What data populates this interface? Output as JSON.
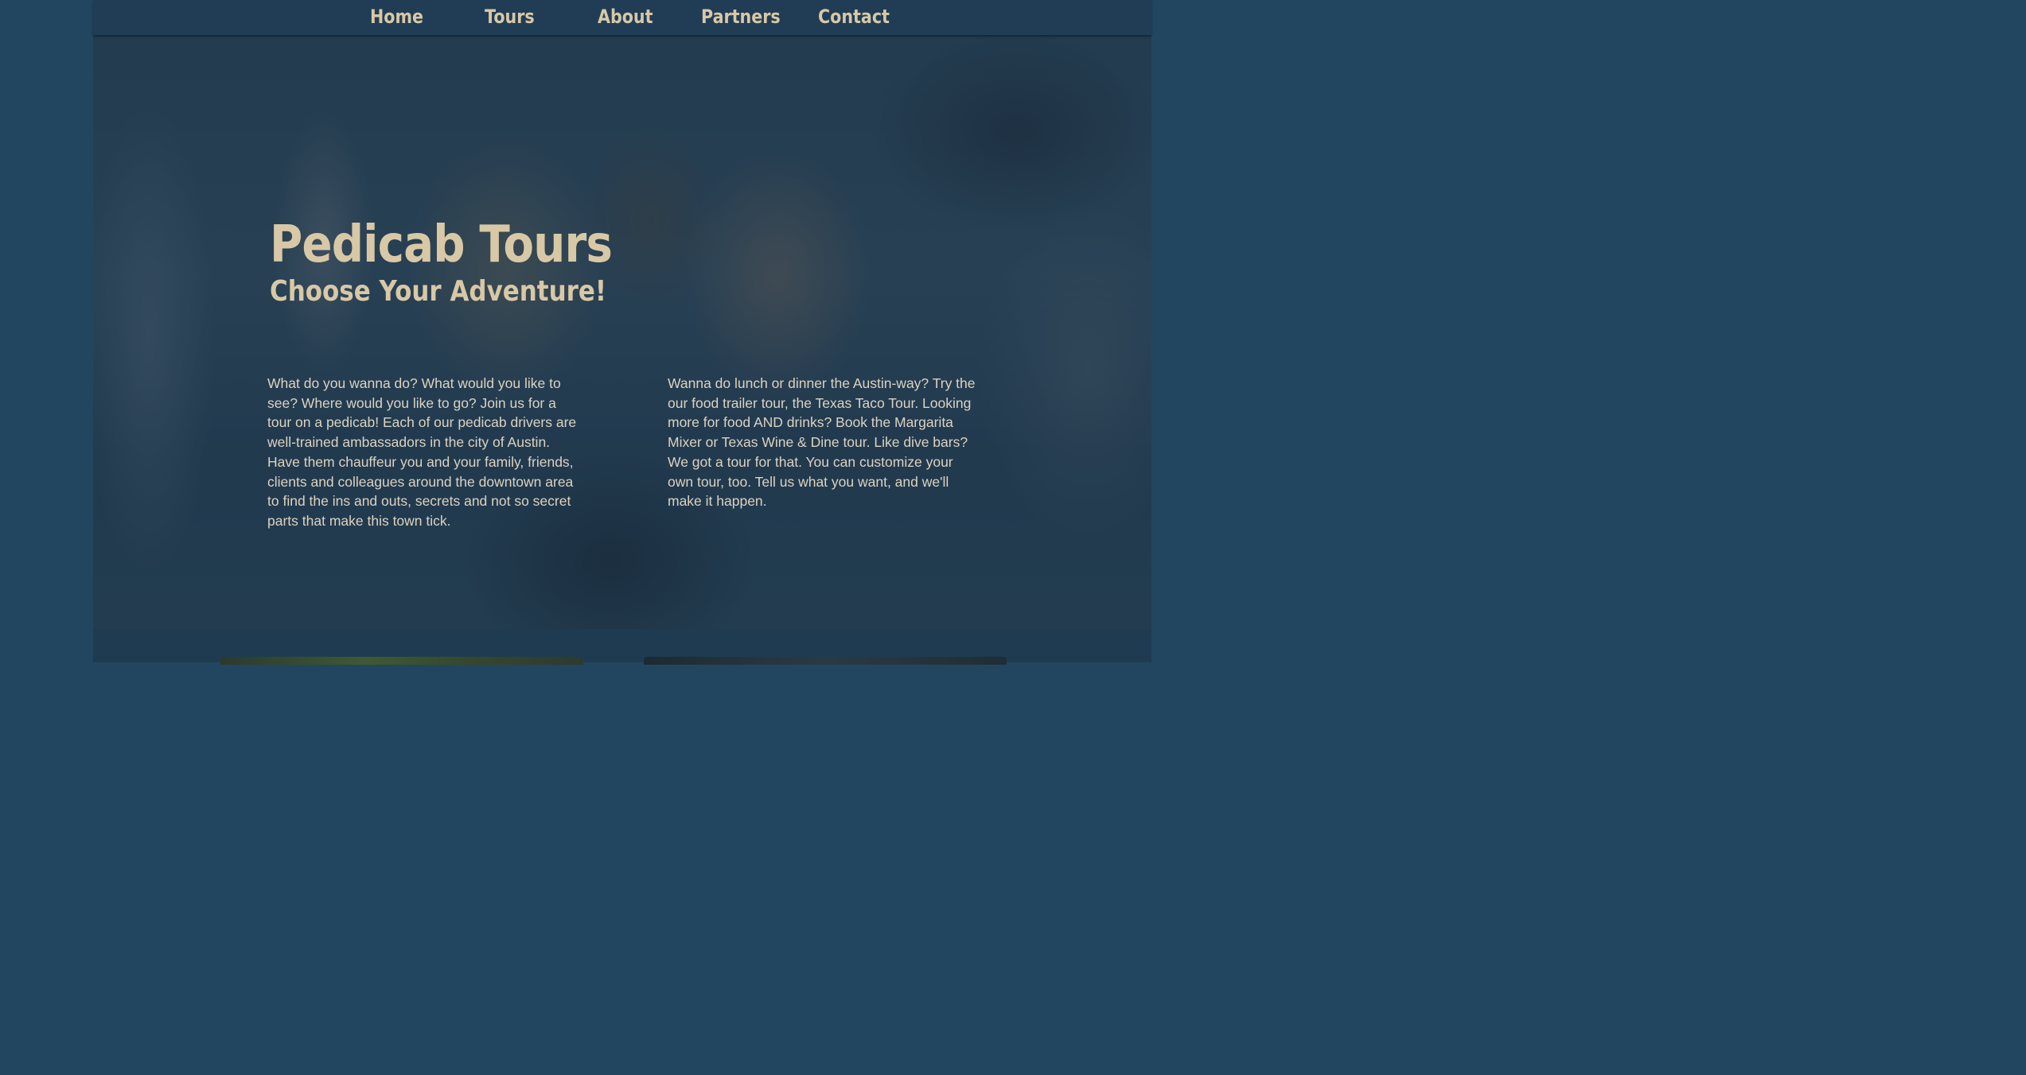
{
  "nav": {
    "items": [
      {
        "label": "Home"
      },
      {
        "label": "Tours"
      },
      {
        "label": "About"
      },
      {
        "label": "Partners"
      },
      {
        "label": "Contact"
      }
    ]
  },
  "hero": {
    "title": "Pedicab Tours",
    "subtitle": "Choose Your Adventure!",
    "paragraph_left": "What do you wanna do? What would you like to see? Where would you like to go? Join us for a tour on a pedicab! Each of our pedicab drivers are well-trained ambassadors in the city of Austin. Have them chauffeur you and your family, friends, clients and colleagues around the downtown area to find the ins and outs, secrets and not so secret parts that make this town tick.",
    "paragraph_right": "Wanna do lunch or dinner the Austin-way? Try the our food trailer tour, the Texas Taco Tour. Looking more for food AND drinks? Book the Margarita Mixer or Texas Wine & Dine tour. Like dive bars? We got a tour for that. You can customize your own tour, too. Tell us what you want, and we'll make it happen."
  },
  "colors": {
    "page_background": "#234660",
    "nav_background": "#203d55",
    "heading_text": "#d8c8a6",
    "body_text": "#dcd3c0"
  }
}
